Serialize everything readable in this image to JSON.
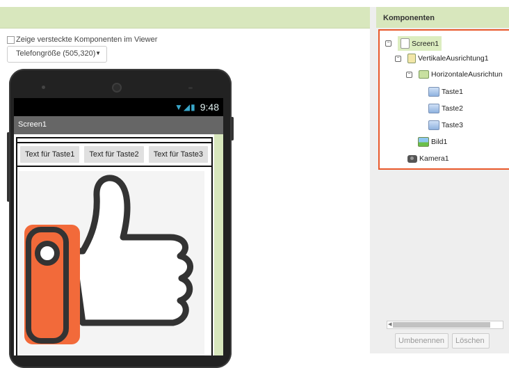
{
  "viewer": {
    "show_hidden_label": "Zeige versteckte Komponenten im Viewer",
    "size_select_value": "Telefongröße (505,320)"
  },
  "phone": {
    "status_time": "9:48",
    "screen_title": "Screen1",
    "buttons": [
      "Text für Taste1",
      "Text für Taste2",
      "Text für Taste3"
    ]
  },
  "components": {
    "header": "Komponenten",
    "tree": [
      {
        "label": "Screen1",
        "icon": "screen-icon",
        "selected": true
      },
      {
        "label": "VertikaleAusrichtung1",
        "icon": "vertical-arrangement-icon"
      },
      {
        "label": "HorizontaleAusrichtun",
        "icon": "horizontal-arrangement-icon"
      },
      {
        "label": "Taste1",
        "icon": "button-icon"
      },
      {
        "label": "Taste2",
        "icon": "button-icon"
      },
      {
        "label": "Taste3",
        "icon": "button-icon"
      },
      {
        "label": "Bild1",
        "icon": "image-icon"
      },
      {
        "label": "Kamera1",
        "icon": "camera-icon"
      }
    ],
    "rename_button": "Umbenennen",
    "delete_button": "Löschen"
  },
  "colors": {
    "accent_green": "#d8e7bd",
    "selection_border": "#e8582a",
    "thumb_orange": "#f26a3a"
  }
}
